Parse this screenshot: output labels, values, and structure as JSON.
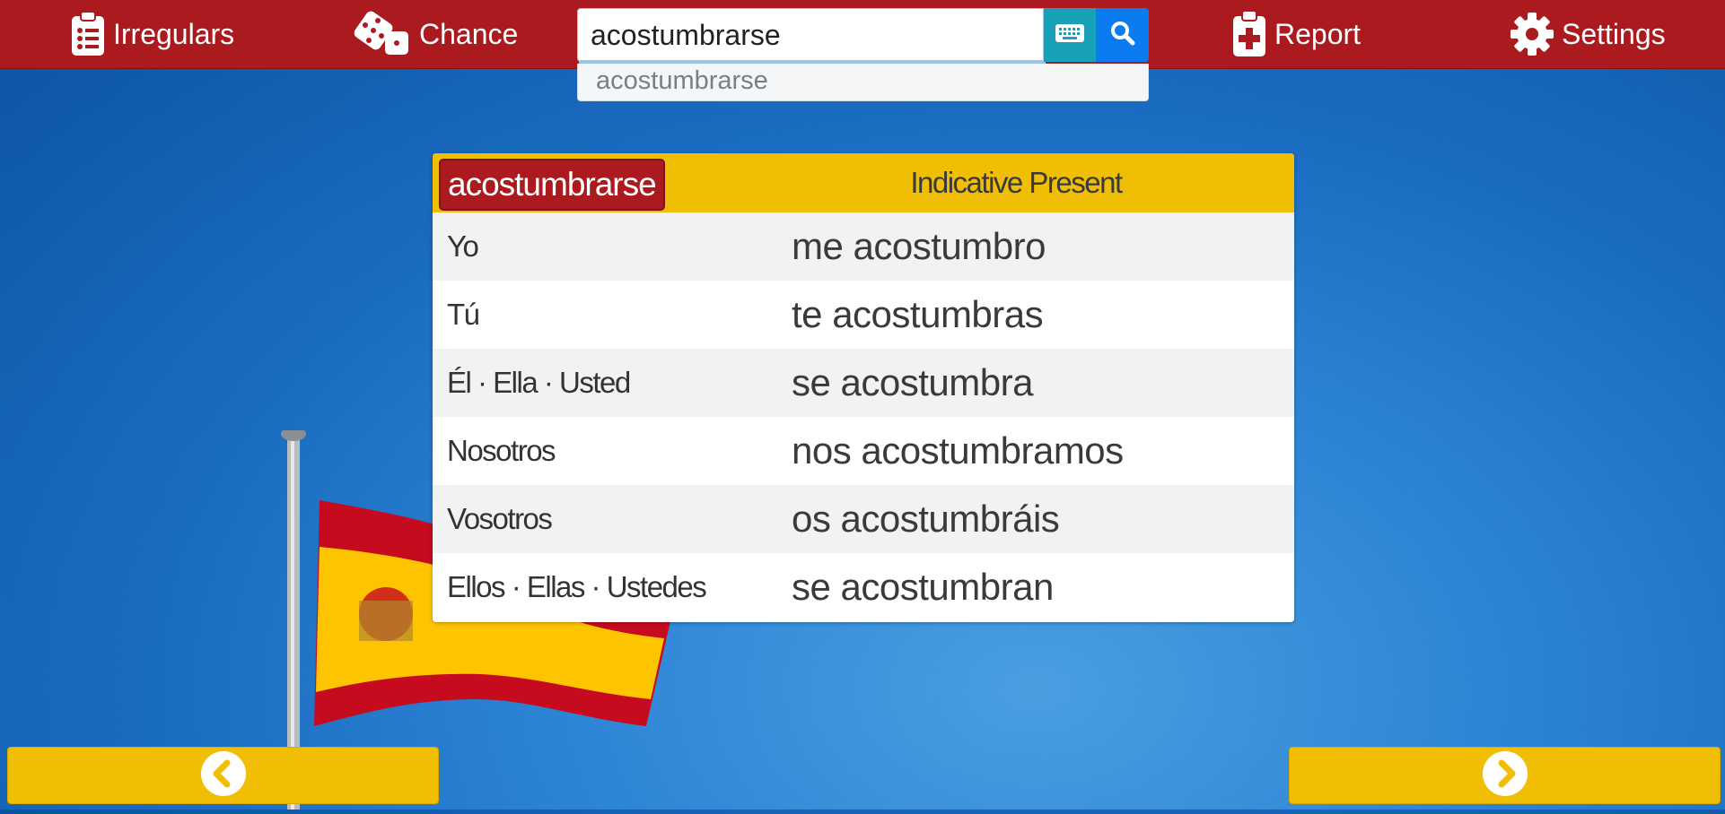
{
  "nav": {
    "irregulars_label": "Irregulars",
    "chance_label": "Chance",
    "report_label": "Report",
    "settings_label": "Settings",
    "icons": [
      "clipboard-list-icon",
      "dice-icon",
      "clipboard-plus-icon",
      "gear-icon"
    ]
  },
  "search": {
    "value": "acostumbrarse",
    "suggestion": "acostumbrarse",
    "keyboard_icon": "keyboard-icon",
    "search_icon": "search-icon"
  },
  "table": {
    "verb": "acostumbrarse",
    "tense": "Indicative Present",
    "rows": [
      {
        "pronoun": "Yo",
        "conjugation": "me acostumbro"
      },
      {
        "pronoun": "Tú",
        "conjugation": "te acostumbras"
      },
      {
        "pronoun": "Él · Ella · Usted",
        "conjugation": "se acostumbra"
      },
      {
        "pronoun": "Nosotros",
        "conjugation": "nos acostumbramos"
      },
      {
        "pronoun": "Vosotros",
        "conjugation": "os acostumbráis"
      },
      {
        "pronoun": "Ellos · Ellas · Ustedes",
        "conjugation": "se acostumbran"
      }
    ]
  },
  "pager": {
    "prev_icon": "chevron-left-circle-icon",
    "next_icon": "chevron-right-circle-icon"
  },
  "colors": {
    "nav_red": "#ab1a1f",
    "accent_yellow": "#f0bf05",
    "search_blue": "#0d7bf0",
    "keyboard_teal": "#17a2b8"
  }
}
